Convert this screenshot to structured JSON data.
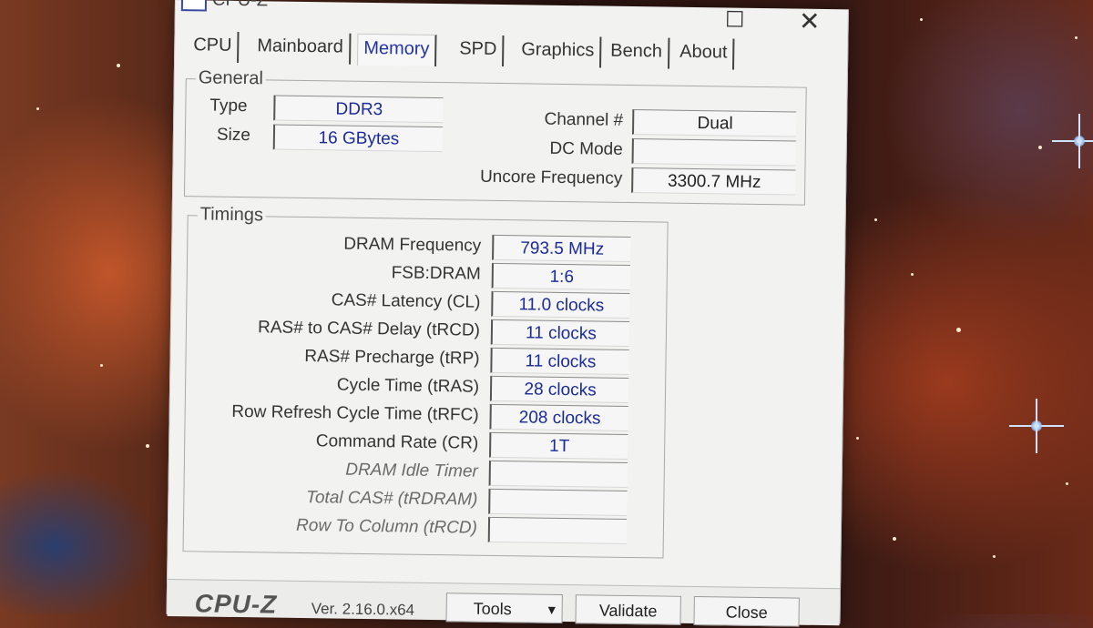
{
  "window": {
    "title": "CPU-Z",
    "maximize_glyph": "☐",
    "close_glyph": "✕"
  },
  "tabs": [
    {
      "label": "CPU"
    },
    {
      "label": "Mainboard"
    },
    {
      "label": "Memory",
      "active": true
    },
    {
      "label": "SPD"
    },
    {
      "label": "Graphics"
    },
    {
      "label": "Bench"
    },
    {
      "label": "About"
    }
  ],
  "general": {
    "legend": "General",
    "type_label": "Type",
    "type_value": "DDR3",
    "size_label": "Size",
    "size_value": "16 GBytes",
    "channel_label": "Channel #",
    "channel_value": "Dual",
    "dcmode_label": "DC Mode",
    "dcmode_value": "",
    "uncore_label": "Uncore Frequency",
    "uncore_value": "3300.7 MHz"
  },
  "timings": {
    "legend": "Timings",
    "rows": [
      {
        "label": "DRAM Frequency",
        "value": "793.5 MHz"
      },
      {
        "label": "FSB:DRAM",
        "value": "1:6"
      },
      {
        "label": "CAS# Latency (CL)",
        "value": "11.0 clocks"
      },
      {
        "label": "RAS# to CAS# Delay (tRCD)",
        "value": "11 clocks"
      },
      {
        "label": "RAS# Precharge (tRP)",
        "value": "11 clocks"
      },
      {
        "label": "Cycle Time (tRAS)",
        "value": "28 clocks"
      },
      {
        "label": "Row Refresh Cycle Time (tRFC)",
        "value": "208 clocks"
      },
      {
        "label": "Command Rate (CR)",
        "value": "1T"
      },
      {
        "label": "DRAM Idle Timer",
        "value": ""
      },
      {
        "label": "Total CAS# (tRDRAM)",
        "value": ""
      },
      {
        "label": "Row To Column (tRCD)",
        "value": ""
      }
    ]
  },
  "footer": {
    "brand": "CPU-Z",
    "version": "Ver. 2.16.0.x64",
    "tools_label": "Tools",
    "tools_arrow": "▼",
    "validate_label": "Validate",
    "close_label": "Close"
  },
  "colors": {
    "value_text": "#1a2a9a",
    "active_tab_text": "#2233aa"
  }
}
